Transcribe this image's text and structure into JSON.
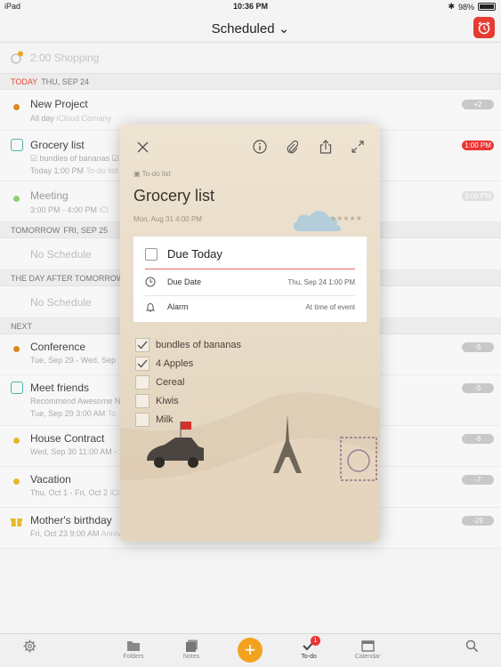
{
  "status": {
    "carrier": "iPad",
    "time": "10:36 PM",
    "battery": "98%"
  },
  "nav": {
    "title": "Scheduled ⌄"
  },
  "next_alarm": {
    "text": "2:00 Shopping"
  },
  "sections": {
    "today": {
      "day": "TODAY",
      "date": "THU, SEP 24"
    },
    "tomorrow": {
      "day": "TOMORROW",
      "date": "FRI, SEP 25"
    },
    "after": {
      "label": "THE DAY AFTER TOMORROW"
    },
    "next": {
      "label": "NEXT"
    }
  },
  "no_schedule": "No Schedule",
  "rows": {
    "new_project": {
      "title": "New Project",
      "sub1": "All day",
      "sub2": "iCloud Comany",
      "badge": "+2"
    },
    "grocery": {
      "title": "Grocery list",
      "sub_items": "☑ bundles of bananas  ☑ 4",
      "sub": "Today 1:00 PM",
      "sub2": "To-do list",
      "badge": "1:00 PM"
    },
    "meeting": {
      "title": "Meeting",
      "sub": "3:00 PM - 4:00 PM",
      "sub2": "iCl",
      "badge": "3:00 PM"
    },
    "conference": {
      "title": "Conference",
      "sub": "Tue, Sep 29 - Wed, Sep",
      "badge": "-5"
    },
    "meet_friends": {
      "title": "Meet friends",
      "sub_items": "Recommend Awesome No",
      "sub": "Tue, Sep 29 3:00 AM",
      "sub2": "To",
      "badge": "-5"
    },
    "house": {
      "title": "House Contract",
      "sub": "Wed, Sep 30 11:00 AM - 12",
      "badge": "-6"
    },
    "vacation": {
      "title": "Vacation",
      "sub": "Thu, Oct 1 - Fri, Oct 2",
      "sub2": "iCl",
      "badge": "-7"
    },
    "birthday": {
      "title": "Mother's birthday",
      "sub": "Fri, Oct 23 9:00 AM",
      "sub2": "Anniversary",
      "badge": "-29"
    }
  },
  "tabs": {
    "folders": "Folders",
    "notes": "Notes",
    "todo": "To-do",
    "todo_badge": "1",
    "calendar": "Calendar"
  },
  "card": {
    "folder": "To-do list",
    "title": "Grocery list",
    "date": "Mon, Aug 31 4:00 PM",
    "stars": "★★★★★",
    "due_today": "Due Today",
    "due_date_label": "Due Date",
    "due_date_value": "Thu, Sep 24 1:00 PM",
    "alarm_label": "Alarm",
    "alarm_value": "At time of event",
    "subtasks": [
      {
        "label": "bundles of bananas",
        "done": true
      },
      {
        "label": "4 Apples",
        "done": true
      },
      {
        "label": "Cereal",
        "done": false
      },
      {
        "label": "Kiwis",
        "done": false
      },
      {
        "label": "Milk",
        "done": false
      }
    ]
  },
  "colors": {
    "accent": "#e53b33",
    "orange": "#e0861a",
    "teal": "#4db3a8",
    "green": "#8fd06e",
    "yellow": "#e6b92a"
  }
}
